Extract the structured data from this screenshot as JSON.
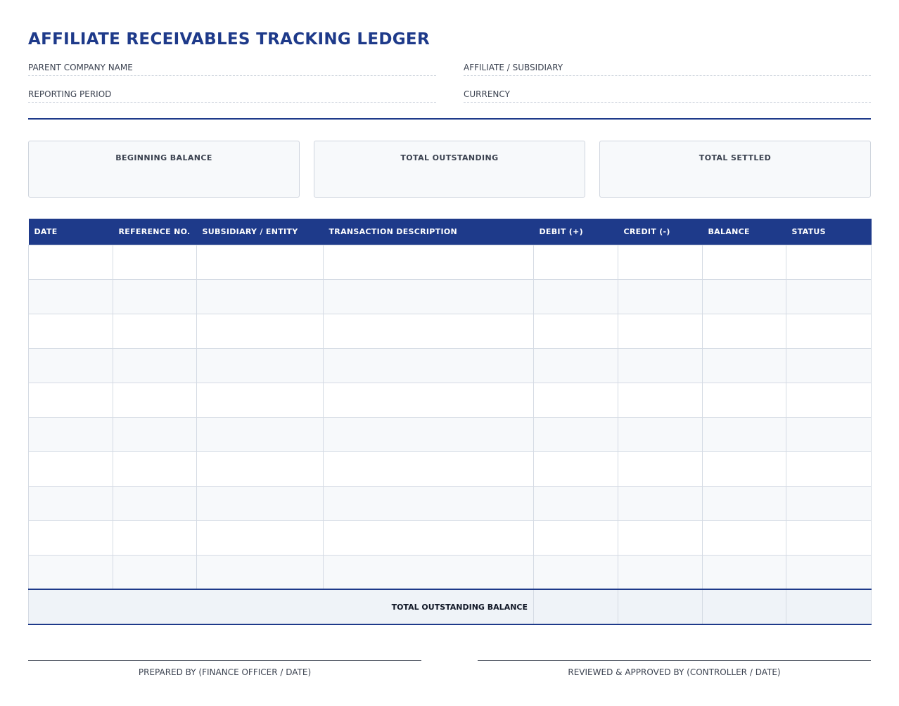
{
  "title": "AFFILIATE RECEIVABLES TRACKING LEDGER",
  "fields": {
    "parent_company": "PARENT COMPANY NAME",
    "affiliate": "AFFILIATE / SUBSIDIARY",
    "reporting_period": "REPORTING PERIOD",
    "currency": "CURRENCY"
  },
  "summary": {
    "beginning_balance": "BEGINNING BALANCE",
    "total_outstanding": "TOTAL OUTSTANDING",
    "total_settled": "TOTAL SETTLED"
  },
  "table": {
    "columns": [
      "DATE",
      "REFERENCE NO.",
      "SUBSIDIARY / ENTITY",
      "TRANSACTION DESCRIPTION",
      "DEBIT (+)",
      "CREDIT (-)",
      "BALANCE",
      "STATUS"
    ],
    "empty_rows": 10,
    "footer_label": "TOTAL OUTSTANDING BALANCE"
  },
  "signatures": {
    "prepared": "PREPARED BY (FINANCE OFFICER / DATE)",
    "reviewed": "REVIEWED & APPROVED BY (CONTROLLER / DATE)"
  },
  "colors": {
    "accent": "#1e3a8a",
    "text": "#3b4250",
    "border": "#d5dbe4",
    "stripe": "#f7f9fb"
  }
}
